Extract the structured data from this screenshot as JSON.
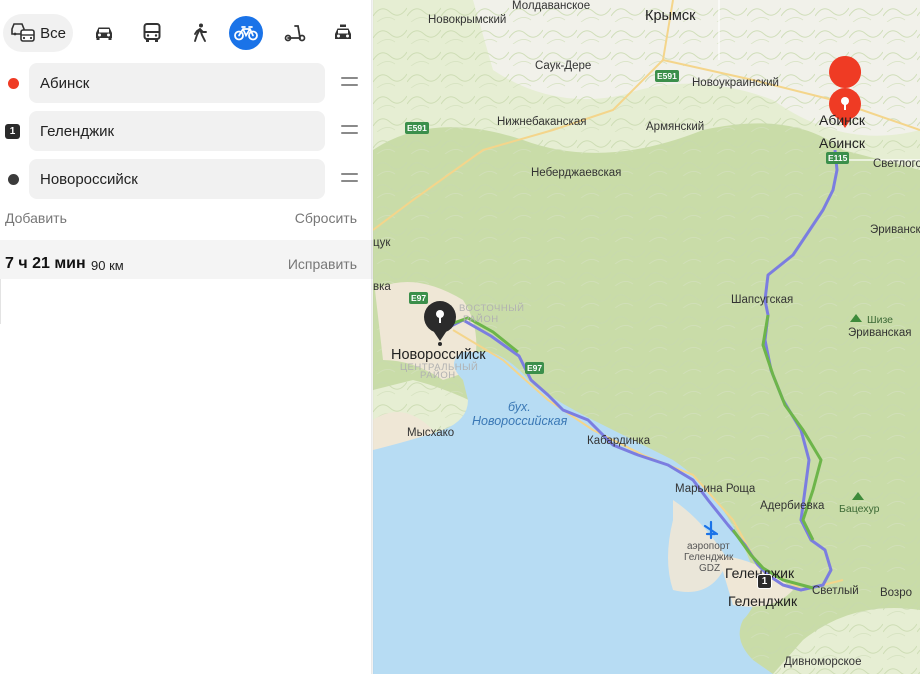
{
  "modes": {
    "all_label": "Все",
    "items": [
      "car-icon",
      "bus-icon",
      "walk-icon",
      "bike-icon",
      "scooter-icon",
      "taxi-icon"
    ],
    "active": "bike-icon",
    "accent": "#1a73e8"
  },
  "waypoints": [
    {
      "value": "Абинск",
      "marker": "red-dot"
    },
    {
      "value": "Геленджик",
      "marker": "1"
    },
    {
      "value": "Новороссийск",
      "marker": "dark-dot"
    }
  ],
  "actions": {
    "add": "Добавить",
    "reset": "Сбросить"
  },
  "route": {
    "time": "7 ч 21 мин",
    "distance": "90 км",
    "fix": "Исправить"
  },
  "map": {
    "labels": {
      "moldavanskoe": "Молдаванское",
      "novokrymsky": "Новокрымский",
      "krymsk": "Крымск",
      "sauk_dere": "Саук-Дере",
      "novoukrainsky": "Новоукраинский",
      "nizhnebakanskaya": "Нижнебаканская",
      "armyansky": "Армянский",
      "neberdzhaevskaya": "Неберджаевская",
      "abinsk": "Абинск",
      "abinsk_2": "Абинск",
      "svetlogor": "Светлогор",
      "erivansky": "Эриванск",
      "shapsugskaya": "Шапсугская",
      "shize": "Шизе",
      "erivanskaya": "Эриванская",
      "novorossiysk": "Новороссийск",
      "vostochny_1": "ВОСТОЧНЫЙ",
      "vostochny_2": "РАЙОН",
      "central_1": "ЦЕНТРАЛЬНЫЙ",
      "central_2": "РАЙОН",
      "bay_1": "бух.",
      "bay_2": "Новороссийская",
      "myskhako": "Мысхако",
      "kabardinka": "Кабардинка",
      "marina_roshcha": "Марьина Роща",
      "aderbievka": "Адербиевка",
      "batsekhur": "Бацехур",
      "airport_1": "аэропорт",
      "airport_2": "Геленджик",
      "airport_3": "GDZ",
      "gelendzhik": "Геленджик",
      "gelendzhik_2": "Геленджик",
      "svetly": "Светлый",
      "vozro": "Возро",
      "divnomorskoe": "Дивноморское",
      "edge_duk": "цук",
      "edge_vka": "вка"
    },
    "shields": {
      "e591_a": "E591",
      "e591_b": "E591",
      "e97_a": "E97",
      "e97_b": "E97",
      "e115": "E115"
    },
    "second_waypoint_marker": "1",
    "colors": {
      "sea": "#b7dcf3",
      "land": "#eaf0dc",
      "route_bike": "#7b7de0",
      "route_walk": "#6db54a",
      "pin_start": "#ef3b24",
      "pin_end": "#2b2b2b"
    }
  }
}
